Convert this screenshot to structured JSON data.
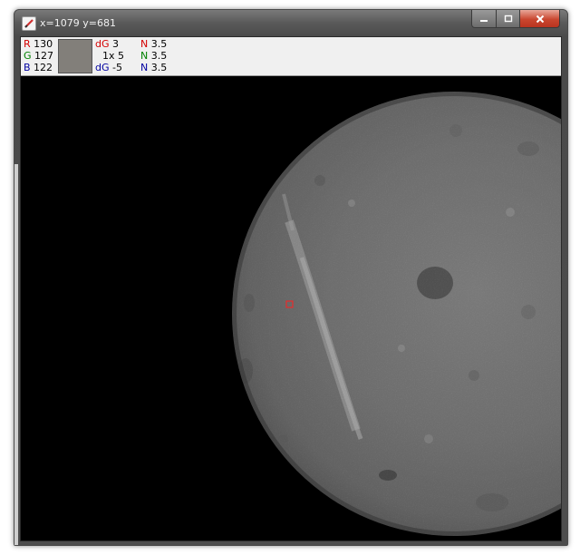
{
  "window": {
    "title": "x=1079 y=681",
    "app_icon": "pencil-icon",
    "buttons": {
      "minimize": "minimize-icon",
      "maximize": "maximize-icon",
      "close": "close-icon"
    }
  },
  "info": {
    "r_label": "R",
    "r_value": "130",
    "g_label": "G",
    "g_value": "127",
    "b_label": "B",
    "b_value": "122",
    "swatch_color": "#827f7a",
    "dg1_label": "dG",
    "dg1_value": "3",
    "zoom_label": "1x",
    "zoom_value": "5",
    "dg2_label": "dG",
    "dg2_value": "-5",
    "n1_label": "N",
    "n1_value": "3.5",
    "n2_label": "N",
    "n2_value": "3.5",
    "n3_label": "N",
    "n3_value": "3.5"
  },
  "colors": {
    "red_label": "#d40000",
    "green_label": "#008000",
    "blue_label": "#0000a0",
    "cursor_box": "#ff2020"
  },
  "image": {
    "subject": "moon",
    "cursor": "selection-box"
  }
}
